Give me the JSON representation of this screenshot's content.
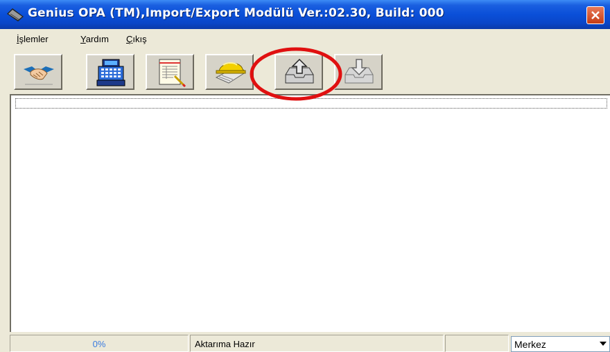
{
  "window": {
    "title": "Genius OPA (TM),Import/Export Modülü Ver.:02.30, Build: 000"
  },
  "menu": [
    {
      "label": "İşlemler",
      "accel": "İ",
      "rest": "şlemler"
    },
    {
      "label": "Yardım",
      "accel": "Y",
      "rest": "ardım"
    },
    {
      "label": "Çıkış",
      "accel": "Ç",
      "rest": "ıkış"
    }
  ],
  "toolbar": [
    {
      "icon": "handshake-icon"
    },
    {
      "icon": "cash-register-icon"
    },
    {
      "icon": "document-edit-icon"
    },
    {
      "icon": "hardhat-blueprint-icon"
    },
    {
      "icon": "tray-upload-icon"
    },
    {
      "icon": "tray-download-icon"
    }
  ],
  "status": {
    "progress": "0%",
    "progress_value": 0,
    "message": "Aktarıma Hazır",
    "branch": "Merkez"
  },
  "colors": {
    "title_blue": "#0a4fd8",
    "close_red": "#c63c14",
    "annotation_red": "#e01010",
    "progress_text": "#3a7be0"
  }
}
